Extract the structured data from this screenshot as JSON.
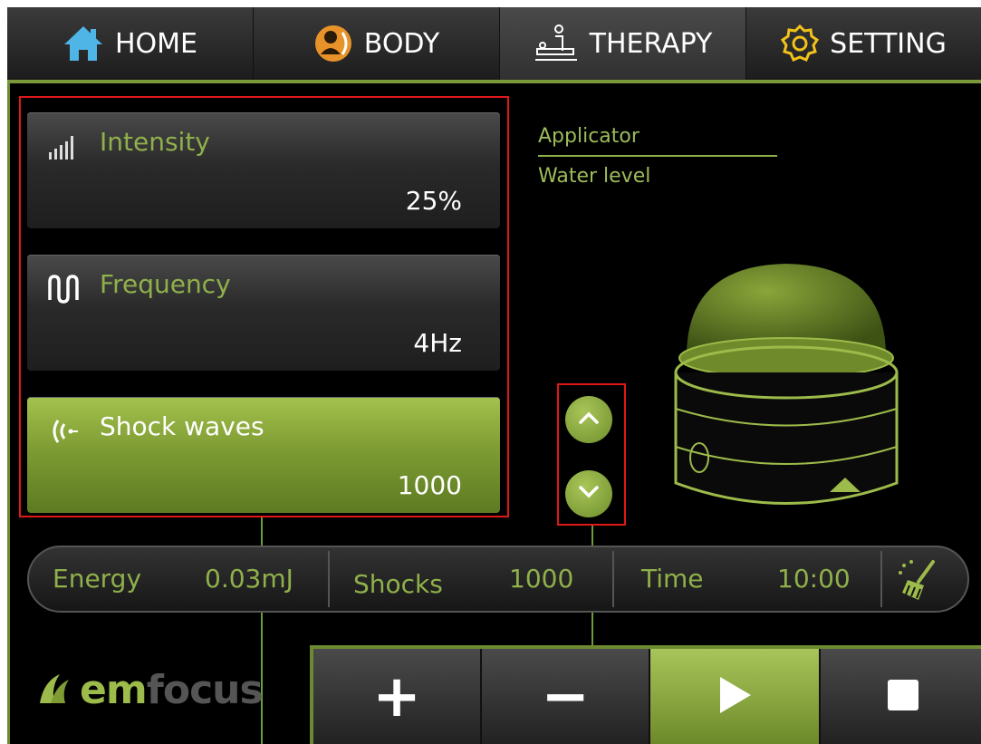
{
  "nav": {
    "tabs": [
      {
        "label": "HOME",
        "icon": "home-icon"
      },
      {
        "label": "BODY",
        "icon": "body-icon"
      },
      {
        "label": "THERAPY",
        "icon": "therapy-icon"
      },
      {
        "label": "SETTING",
        "icon": "gear-icon"
      }
    ],
    "active": "THERAPY"
  },
  "params": [
    {
      "title": "Intensity",
      "value": "25%",
      "icon": "signal-bars-icon"
    },
    {
      "title": "Frequency",
      "value": "4Hz",
      "icon": "waveform-icon"
    },
    {
      "title": "Shock waves",
      "value": "1000",
      "icon": "shockwave-icon"
    }
  ],
  "info": {
    "applicator_label": "Applicator",
    "water_level_label": "Water level"
  },
  "status": {
    "energy_label": "Energy",
    "energy_value": "0.03mJ",
    "shocks_label": "Shocks",
    "shocks_value": "1000",
    "time_label": "Time",
    "time_value": "10:00",
    "clean_icon": "broom-icon"
  },
  "logo": {
    "brand_prefix": "em",
    "brand_suffix": "focus"
  },
  "toolbar": {
    "plus": "+",
    "minus": "−",
    "play_icon": "play-icon",
    "stop_icon": "stop-icon"
  },
  "colors": {
    "accent": "#8fb04a",
    "annotation": "#e01818"
  }
}
